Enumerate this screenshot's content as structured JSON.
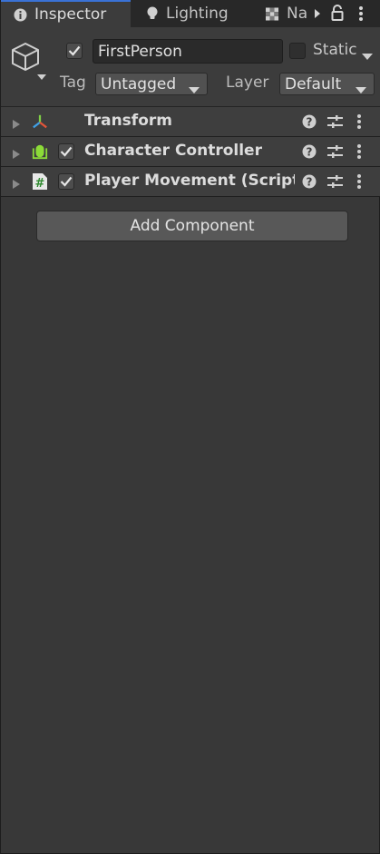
{
  "tabs": [
    {
      "label": "Inspector",
      "icon": "info-icon"
    },
    {
      "label": "Lighting",
      "icon": "lightbulb-icon"
    },
    {
      "label": "Na",
      "icon": "navigation-icon"
    }
  ],
  "header": {
    "object_name": "FirstPerson",
    "active": true,
    "static_label": "Static",
    "static_checked": false,
    "tag_label": "Tag",
    "tag_value": "Untagged",
    "layer_label": "Layer",
    "layer_value": "Default"
  },
  "components": [
    {
      "label": "Transform",
      "icon": "transform-icon",
      "has_toggle": false
    },
    {
      "label": "Character Controller",
      "icon": "character-controller-icon",
      "has_toggle": true,
      "enabled": true
    },
    {
      "label": "Player Movement (Script",
      "icon": "script-icon",
      "has_toggle": true,
      "enabled": true
    }
  ],
  "add_component_label": "Add Component",
  "colors": {
    "accent": "#3a72d6",
    "panel": "#383838",
    "header": "#3c3c3c"
  }
}
